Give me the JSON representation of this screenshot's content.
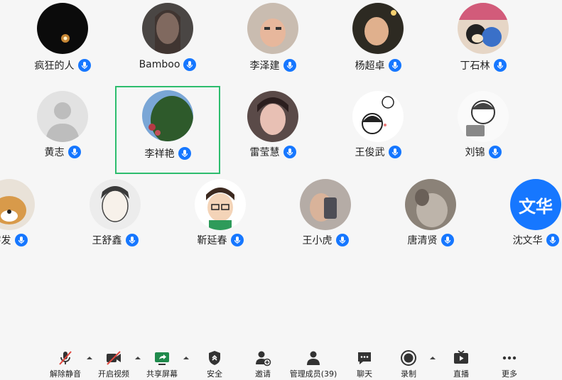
{
  "participants": [
    {
      "name": "疯狂的人"
    },
    {
      "name": "Bamboo"
    },
    {
      "name": "李泽建"
    },
    {
      "name": "杨超卓"
    },
    {
      "name": "丁石林"
    },
    {
      "name": "黄志"
    },
    {
      "name": "李祥艳"
    },
    {
      "name": "雷莹慧"
    },
    {
      "name": "王俊武"
    },
    {
      "name": "刘锦"
    },
    {
      "name": "字发"
    },
    {
      "name": "王舒鑫"
    },
    {
      "name": "靳延春"
    },
    {
      "name": "王小虎"
    },
    {
      "name": "唐清贤"
    },
    {
      "name": "沈文华",
      "avatar_text": "文华",
      "avatar_color": "#1677ff"
    }
  ],
  "active_speaker": "李祥艳",
  "toolbar": {
    "unmute": "解除静音",
    "video": "开启视频",
    "share": "共享屏幕",
    "security": "安全",
    "invite": "邀请",
    "members": "管理成员(39)",
    "chat": "聊天",
    "record": "录制",
    "live": "直播",
    "more": "更多"
  },
  "colors": {
    "accent": "#1677ff",
    "active_border": "#2dbd6e",
    "background": "#f6f6f6",
    "muted_red": "#e0463d"
  }
}
